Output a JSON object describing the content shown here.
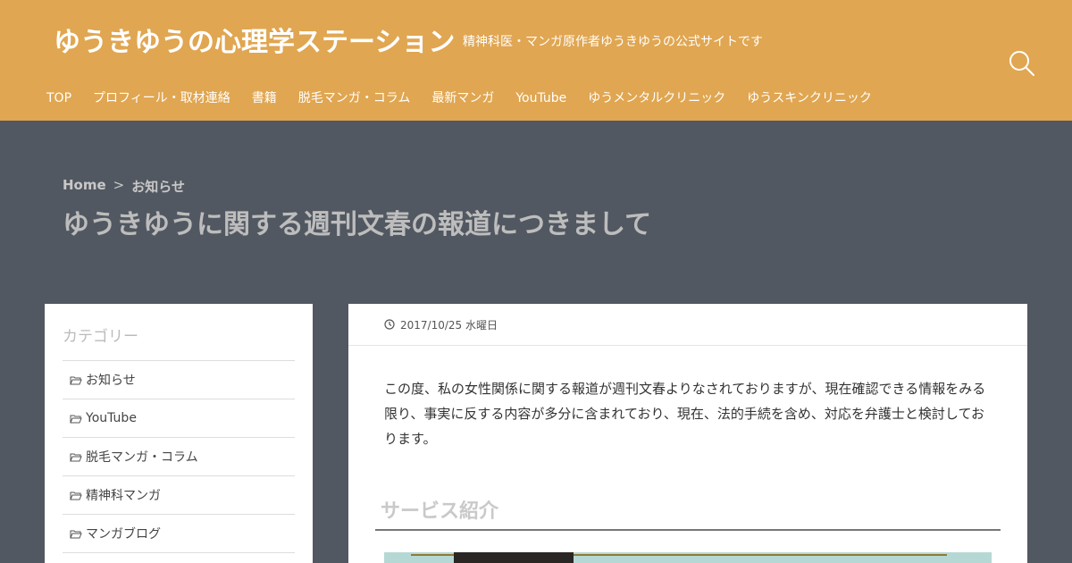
{
  "header": {
    "site_title": "ゆうきゆうの心理学ステーション",
    "tagline": "精神科医・マンガ原作者ゆうきゆうの公式サイトです",
    "search_icon": "search-icon"
  },
  "nav": {
    "items": [
      {
        "label": "TOP"
      },
      {
        "label": "プロフィール・取材連絡"
      },
      {
        "label": "書籍"
      },
      {
        "label": "脱毛マンガ・コラム"
      },
      {
        "label": "最新マンガ"
      },
      {
        "label": "YouTube"
      },
      {
        "label": "ゆうメンタルクリニック"
      },
      {
        "label": "ゆうスキンクリニック"
      }
    ]
  },
  "breadcrumb": {
    "home": "Home",
    "separator": ">",
    "current": "お知らせ"
  },
  "page": {
    "title": "ゆうきゆうに関する週刊文春の報道につきまして"
  },
  "sidebar": {
    "heading": "カテゴリー",
    "categories": [
      {
        "label": "お知らせ",
        "icon": "folder-open-icon"
      },
      {
        "label": "YouTube",
        "icon": "folder-open-icon"
      },
      {
        "label": "脱毛マンガ・コラム",
        "icon": "folder-open-icon"
      },
      {
        "label": "精神科マンガ",
        "icon": "folder-open-icon"
      },
      {
        "label": "マンガブログ",
        "icon": "folder-open-icon"
      }
    ]
  },
  "article": {
    "date": "2017/10/25 水曜日",
    "body": "この度、私の女性関係に関する報道が週刊文春よりなされておりますが、現在確認できる情報をみる限り、事実に反する内容が多分に含まれており、現在、法的手続を含め、対応を弁護士と検討しております。",
    "section_heading": "サービス紹介"
  },
  "colors": {
    "header_bg": "#e0a651",
    "page_bg": "#525861",
    "card_bg": "#ffffff"
  }
}
